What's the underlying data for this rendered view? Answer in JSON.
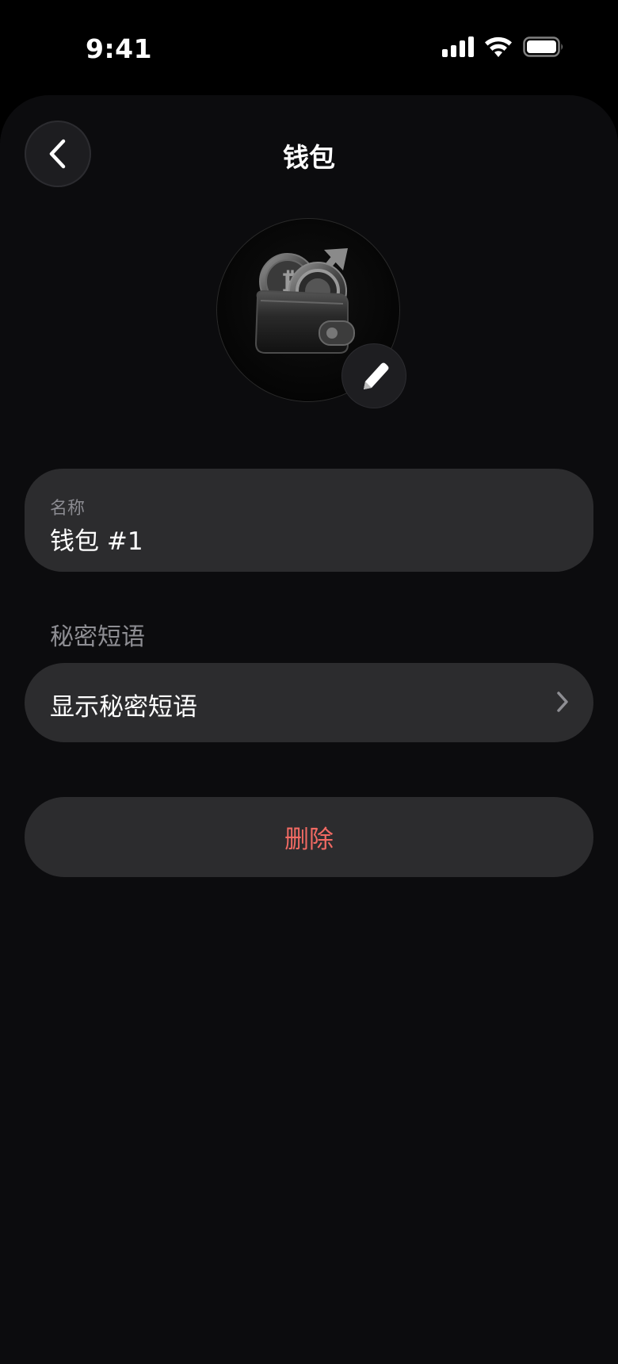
{
  "status_bar": {
    "time": "9:41",
    "icons": [
      "cellular-signal-icon",
      "wifi-icon",
      "battery-icon"
    ]
  },
  "header": {
    "title": "钱包",
    "back_icon": "chevron-left-icon"
  },
  "avatar": {
    "image": "wallet-coins-image",
    "edit_icon": "pencil-icon"
  },
  "name_field": {
    "label": "名称",
    "value": "钱包 #1"
  },
  "secret_section": {
    "label": "秘密短语",
    "row_label": "显示秘密短语",
    "row_icon": "chevron-right-icon"
  },
  "delete_button": {
    "label": "删除"
  },
  "colors": {
    "background": "#0c0c0e",
    "card": "#2c2c2e",
    "secondary_text": "#8e8e93",
    "destructive": "#f26a63"
  }
}
